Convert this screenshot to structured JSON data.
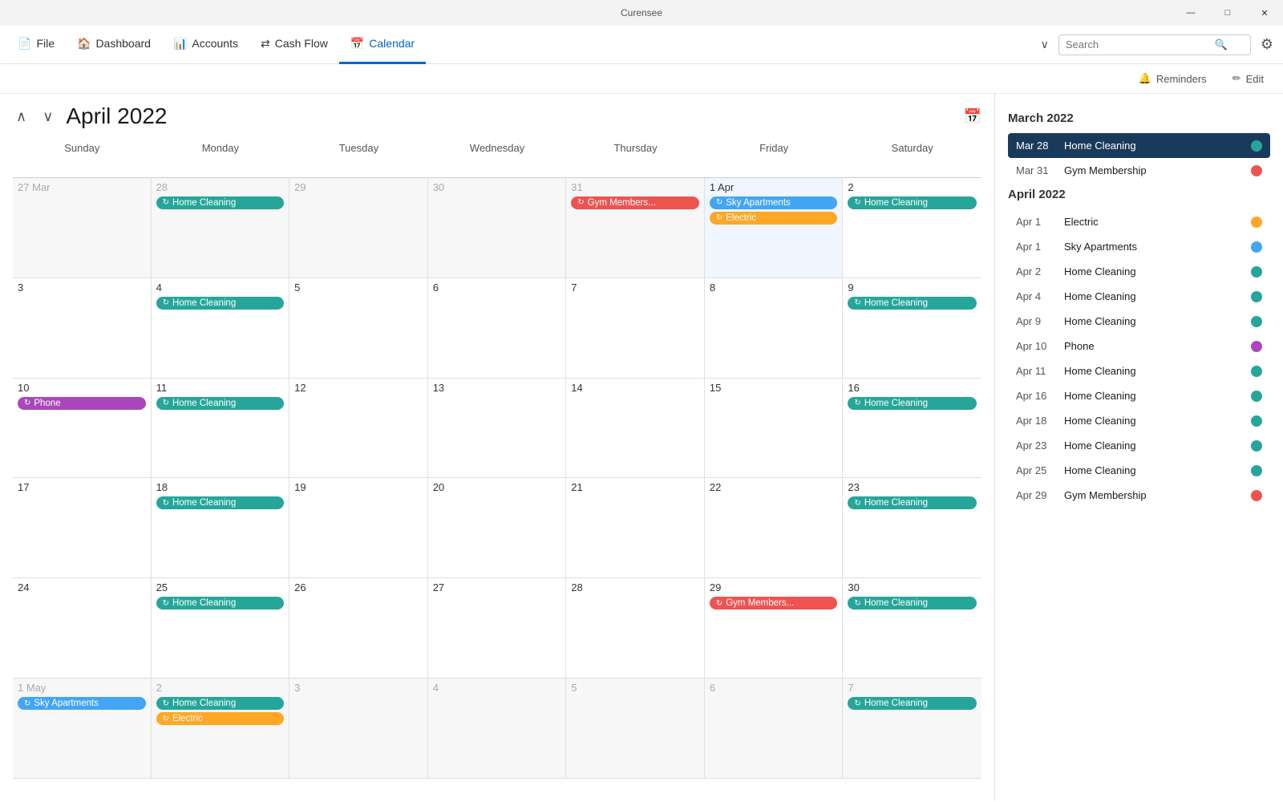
{
  "app": {
    "title": "Curensee"
  },
  "titlebar": {
    "minimize": "—",
    "maximize": "□",
    "close": "✕"
  },
  "menubar": {
    "items": [
      {
        "id": "file",
        "icon": "📄",
        "label": "File"
      },
      {
        "id": "dashboard",
        "icon": "🏠",
        "label": "Dashboard"
      },
      {
        "id": "accounts",
        "icon": "📊",
        "label": "Accounts"
      },
      {
        "id": "cashflow",
        "icon": "⇄",
        "label": "Cash Flow"
      },
      {
        "id": "calendar",
        "icon": "📅",
        "label": "Calendar"
      }
    ],
    "search_placeholder": "Search"
  },
  "toolbar": {
    "reminders_label": "Reminders",
    "edit_label": "Edit"
  },
  "calendar": {
    "title": "April 2022",
    "nav_up": "∧",
    "nav_down": "∨",
    "day_headers": [
      "Sunday",
      "Monday",
      "Tuesday",
      "Wednesday",
      "Thursday",
      "Friday",
      "Saturday"
    ],
    "weeks": [
      [
        {
          "date": "27",
          "label": "27 Mar",
          "month": "prev",
          "events": []
        },
        {
          "date": "28",
          "label": "28",
          "month": "prev",
          "events": [
            {
              "type": "green",
              "text": "Home Cleaning"
            }
          ]
        },
        {
          "date": "29",
          "label": "29",
          "month": "prev",
          "events": []
        },
        {
          "date": "30",
          "label": "30",
          "month": "prev",
          "events": []
        },
        {
          "date": "31",
          "label": "31",
          "month": "prev",
          "events": [
            {
              "type": "red",
              "text": "Gym Members..."
            }
          ]
        },
        {
          "date": "1 Apr",
          "label": "1 Apr",
          "month": "curr",
          "today": true,
          "events": [
            {
              "type": "blue",
              "text": "Sky Apartments"
            },
            {
              "type": "orange",
              "text": "Electric"
            }
          ]
        },
        {
          "date": "2",
          "label": "2",
          "month": "curr",
          "events": [
            {
              "type": "green",
              "text": "Home Cleaning"
            }
          ]
        }
      ],
      [
        {
          "date": "3",
          "label": "3",
          "month": "curr",
          "events": []
        },
        {
          "date": "4",
          "label": "4",
          "month": "curr",
          "events": [
            {
              "type": "green",
              "text": "Home Cleaning"
            }
          ]
        },
        {
          "date": "5",
          "label": "5",
          "month": "curr",
          "events": []
        },
        {
          "date": "6",
          "label": "6",
          "month": "curr",
          "events": []
        },
        {
          "date": "7",
          "label": "7",
          "month": "curr",
          "events": []
        },
        {
          "date": "8",
          "label": "8",
          "month": "curr",
          "events": []
        },
        {
          "date": "9",
          "label": "9",
          "month": "curr",
          "events": [
            {
              "type": "green",
              "text": "Home Cleaning"
            }
          ]
        }
      ],
      [
        {
          "date": "10",
          "label": "10",
          "month": "curr",
          "events": [
            {
              "type": "purple",
              "text": "Phone"
            }
          ]
        },
        {
          "date": "11",
          "label": "11",
          "month": "curr",
          "events": [
            {
              "type": "green",
              "text": "Home Cleaning"
            }
          ]
        },
        {
          "date": "12",
          "label": "12",
          "month": "curr",
          "events": []
        },
        {
          "date": "13",
          "label": "13",
          "month": "curr",
          "events": []
        },
        {
          "date": "14",
          "label": "14",
          "month": "curr",
          "events": []
        },
        {
          "date": "15",
          "label": "15",
          "month": "curr",
          "events": []
        },
        {
          "date": "16",
          "label": "16",
          "month": "curr",
          "events": [
            {
              "type": "green",
              "text": "Home Cleaning"
            }
          ]
        }
      ],
      [
        {
          "date": "17",
          "label": "17",
          "month": "curr",
          "events": []
        },
        {
          "date": "18",
          "label": "18",
          "month": "curr",
          "events": [
            {
              "type": "green",
              "text": "Home Cleaning"
            }
          ]
        },
        {
          "date": "19",
          "label": "19",
          "month": "curr",
          "events": []
        },
        {
          "date": "20",
          "label": "20",
          "month": "curr",
          "events": []
        },
        {
          "date": "21",
          "label": "21",
          "month": "curr",
          "events": []
        },
        {
          "date": "22",
          "label": "22",
          "month": "curr",
          "events": []
        },
        {
          "date": "23",
          "label": "23",
          "month": "curr",
          "events": [
            {
              "type": "green",
              "text": "Home Cleaning"
            }
          ]
        }
      ],
      [
        {
          "date": "24",
          "label": "24",
          "month": "curr",
          "events": []
        },
        {
          "date": "25",
          "label": "25",
          "month": "curr",
          "events": [
            {
              "type": "green",
              "text": "Home Cleaning"
            }
          ]
        },
        {
          "date": "26",
          "label": "26",
          "month": "curr",
          "events": []
        },
        {
          "date": "27",
          "label": "27",
          "month": "curr",
          "events": []
        },
        {
          "date": "28",
          "label": "28",
          "month": "curr",
          "events": []
        },
        {
          "date": "29",
          "label": "29",
          "month": "curr",
          "events": [
            {
              "type": "red",
              "text": "Gym Members..."
            }
          ]
        },
        {
          "date": "30",
          "label": "30",
          "month": "curr",
          "events": [
            {
              "type": "green",
              "text": "Home Cleaning"
            }
          ]
        }
      ],
      [
        {
          "date": "1 May",
          "label": "1 May",
          "month": "next",
          "events": [
            {
              "type": "blue",
              "text": "Sky Apartments"
            }
          ]
        },
        {
          "date": "2",
          "label": "2",
          "month": "next",
          "events": [
            {
              "type": "green",
              "text": "Home Cleaning"
            },
            {
              "type": "orange",
              "text": "Electric"
            }
          ]
        },
        {
          "date": "3",
          "label": "3",
          "month": "next",
          "events": []
        },
        {
          "date": "4",
          "label": "4",
          "month": "next",
          "events": []
        },
        {
          "date": "5",
          "label": "5",
          "month": "next",
          "events": []
        },
        {
          "date": "6",
          "label": "6",
          "month": "next",
          "events": []
        },
        {
          "date": "7",
          "label": "7",
          "month": "next",
          "events": [
            {
              "type": "green",
              "text": "Home Cleaning"
            }
          ]
        }
      ]
    ]
  },
  "sidebar": {
    "march_title": "March 2022",
    "april_title": "April 2022",
    "items": [
      {
        "date": "Mar 28",
        "name": "Home Cleaning",
        "dot": "green",
        "selected": true
      },
      {
        "date": "Mar 31",
        "name": "Gym Membership",
        "dot": "red",
        "selected": false
      },
      {
        "date": "Apr 1",
        "name": "Electric",
        "dot": "orange",
        "selected": false
      },
      {
        "date": "Apr 1",
        "name": "Sky Apartments",
        "dot": "blue",
        "selected": false
      },
      {
        "date": "Apr 2",
        "name": "Home Cleaning",
        "dot": "green",
        "selected": false
      },
      {
        "date": "Apr 4",
        "name": "Home Cleaning",
        "dot": "green",
        "selected": false
      },
      {
        "date": "Apr 9",
        "name": "Home Cleaning",
        "dot": "green",
        "selected": false
      },
      {
        "date": "Apr 10",
        "name": "Phone",
        "dot": "purple",
        "selected": false
      },
      {
        "date": "Apr 11",
        "name": "Home Cleaning",
        "dot": "green",
        "selected": false
      },
      {
        "date": "Apr 16",
        "name": "Home Cleaning",
        "dot": "green",
        "selected": false
      },
      {
        "date": "Apr 18",
        "name": "Home Cleaning",
        "dot": "green",
        "selected": false
      },
      {
        "date": "Apr 23",
        "name": "Home Cleaning",
        "dot": "green",
        "selected": false
      },
      {
        "date": "Apr 25",
        "name": "Home Cleaning",
        "dot": "green",
        "selected": false
      },
      {
        "date": "Apr 29",
        "name": "Gym Membership",
        "dot": "red",
        "selected": false
      }
    ]
  }
}
